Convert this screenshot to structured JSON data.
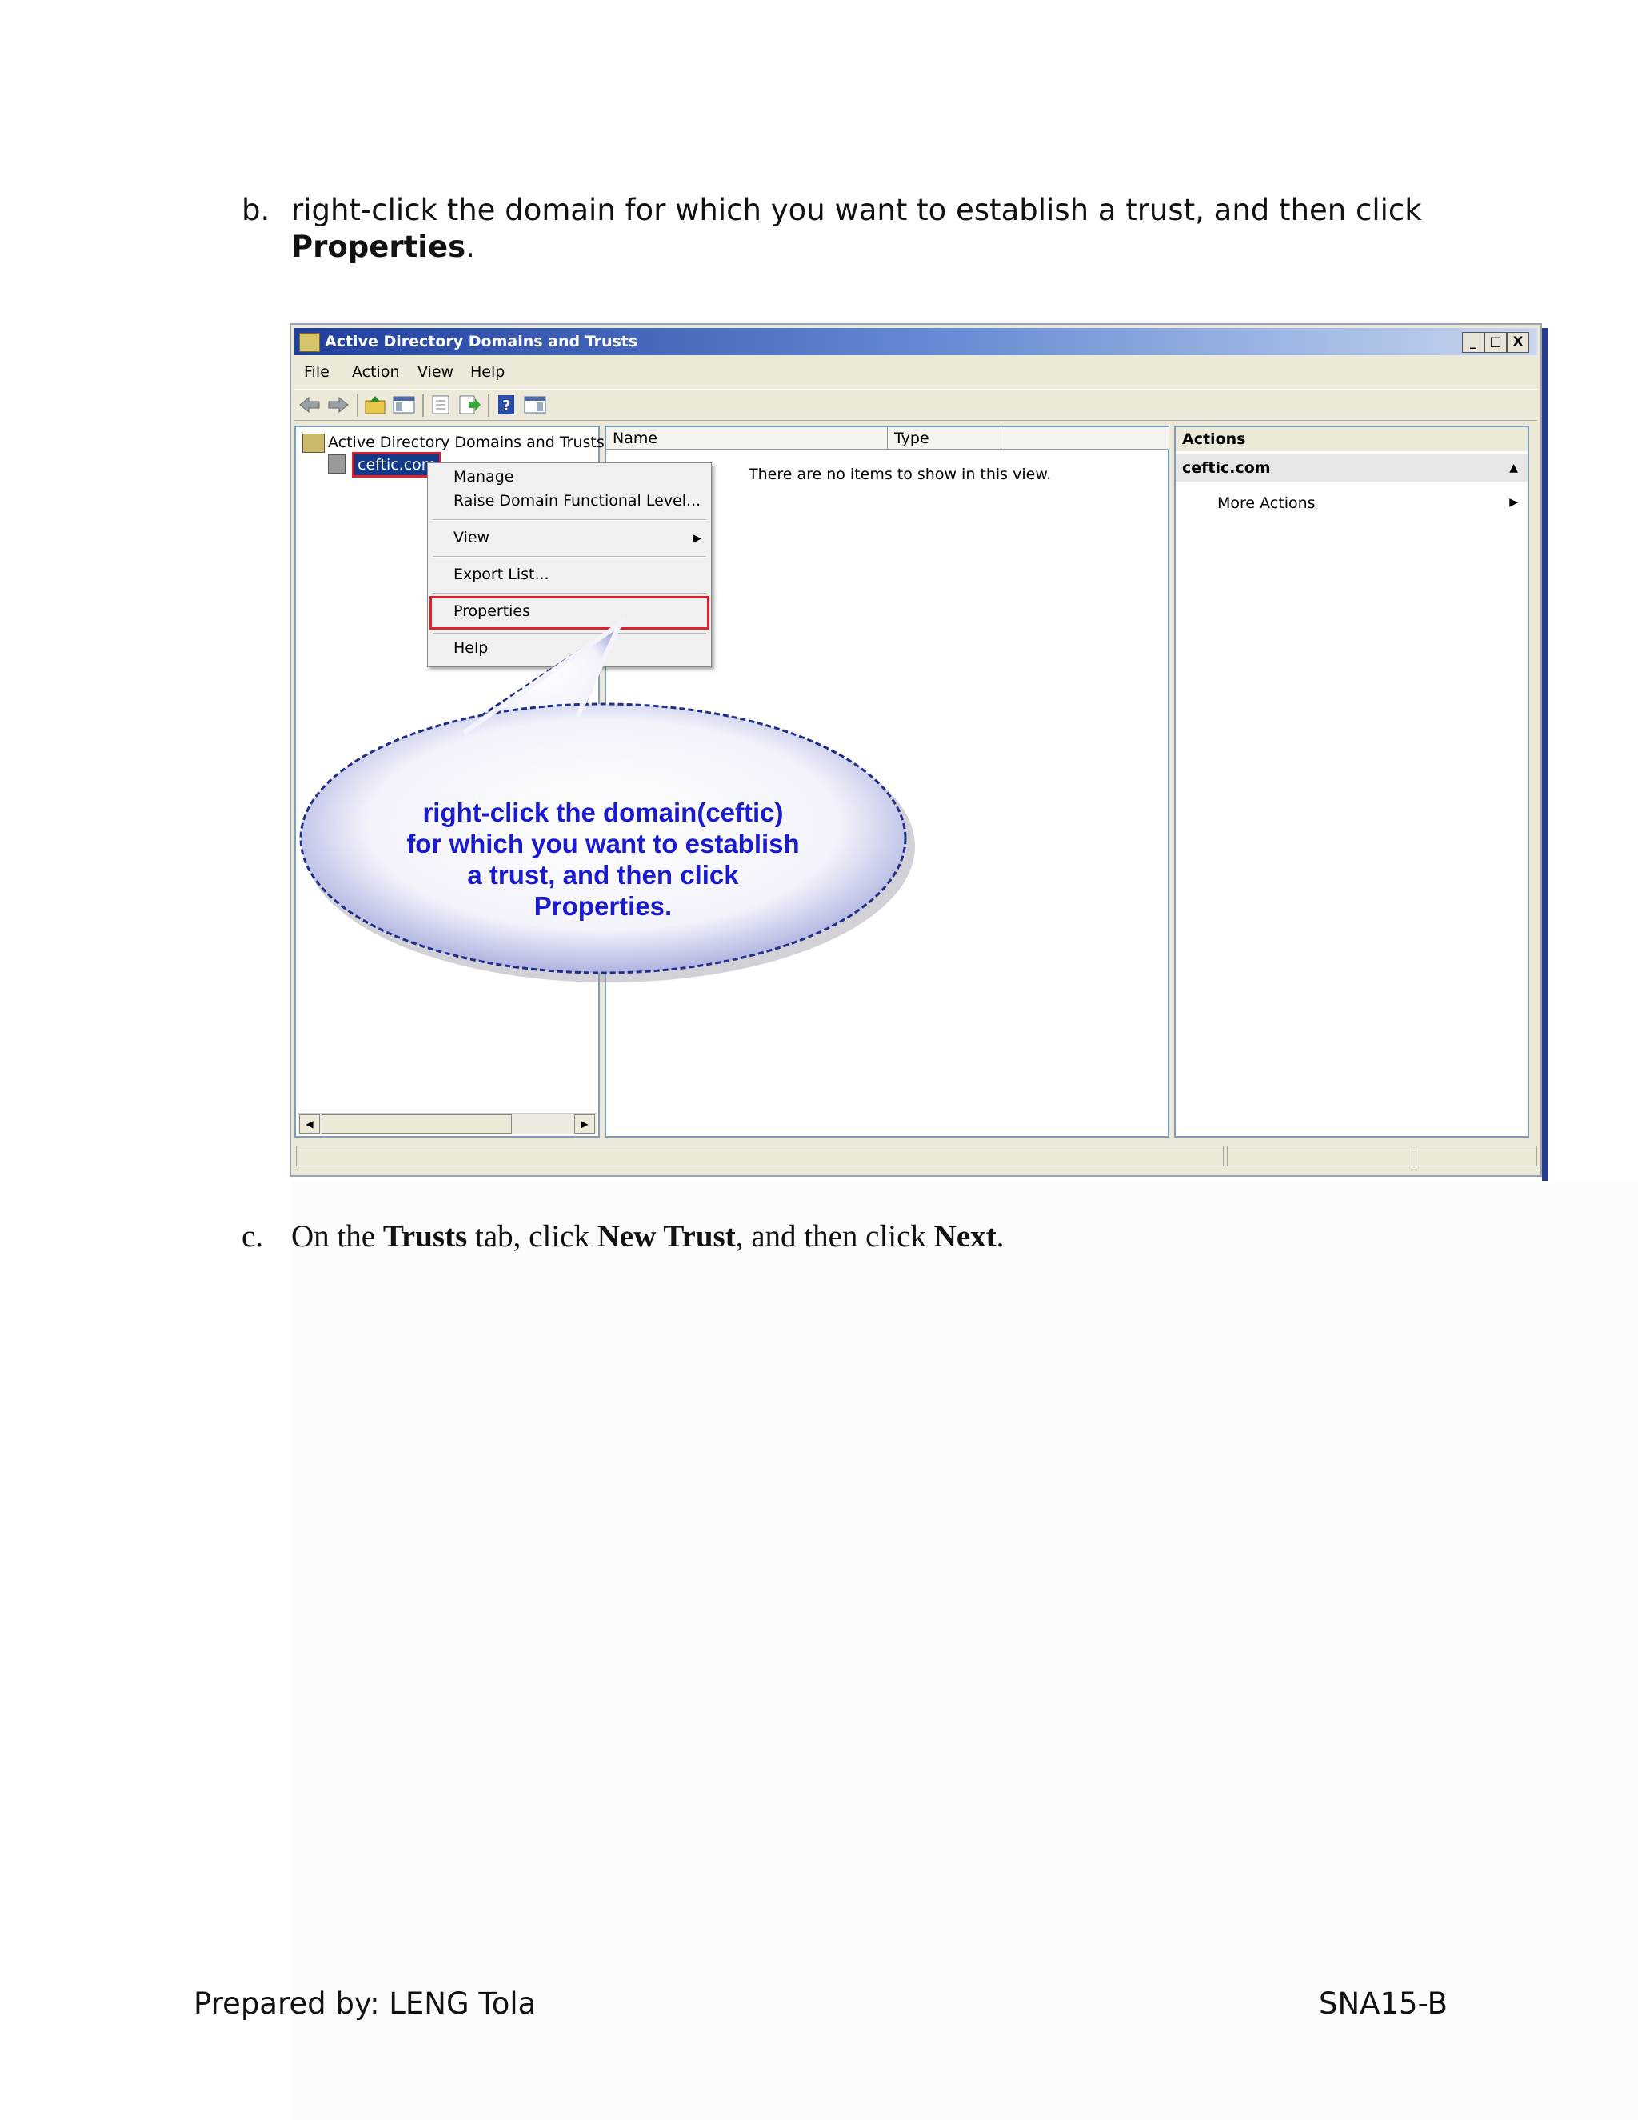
{
  "step_b": {
    "letter": "b.",
    "text": "right-click the domain for which you want to establish a trust, and then click",
    "bold": "Properties",
    "period": "."
  },
  "screenshot": {
    "title": "Active Directory Domains and Trusts",
    "window_buttons": [
      "_",
      "□",
      "X"
    ],
    "menu": [
      "File",
      "Action",
      "View",
      "Help"
    ],
    "toolbar_icons": [
      "back-icon",
      "forward-icon",
      "up-folder-icon",
      "show-hide-tree-icon",
      "properties-icon",
      "export-icon",
      "help-icon",
      "show-hide-action-pane-icon"
    ],
    "tree": {
      "root": "Active Directory Domains and Trusts [I",
      "domain": "ceftic.com"
    },
    "list": {
      "columns": [
        "Name",
        "Type"
      ],
      "empty_message": "There are no items to show in this view."
    },
    "actions": {
      "header": "Actions",
      "section": "ceftic.com",
      "item": "More Actions"
    },
    "context_menu": {
      "items": [
        "Manage",
        "Raise Domain Functional Level...",
        "View",
        "Export List...",
        "Properties",
        "Help"
      ]
    },
    "callout": "right-click the domain(ceftic) for which you want to establish a trust, and then click Properties.",
    "colors": {
      "highlight": "#e0202a",
      "callout_text": "#1a1ad0",
      "selection": "#123a8a"
    }
  },
  "step_c": {
    "letter": "c.",
    "p1": "On the ",
    "b1": "Trusts",
    "p2": " tab, click ",
    "b2": "New Trust",
    "p3": ", and then click ",
    "b3": "Next",
    "p4": "."
  },
  "footer": {
    "left": "Prepared by: LENG Tola",
    "right": "SNA15-B"
  }
}
